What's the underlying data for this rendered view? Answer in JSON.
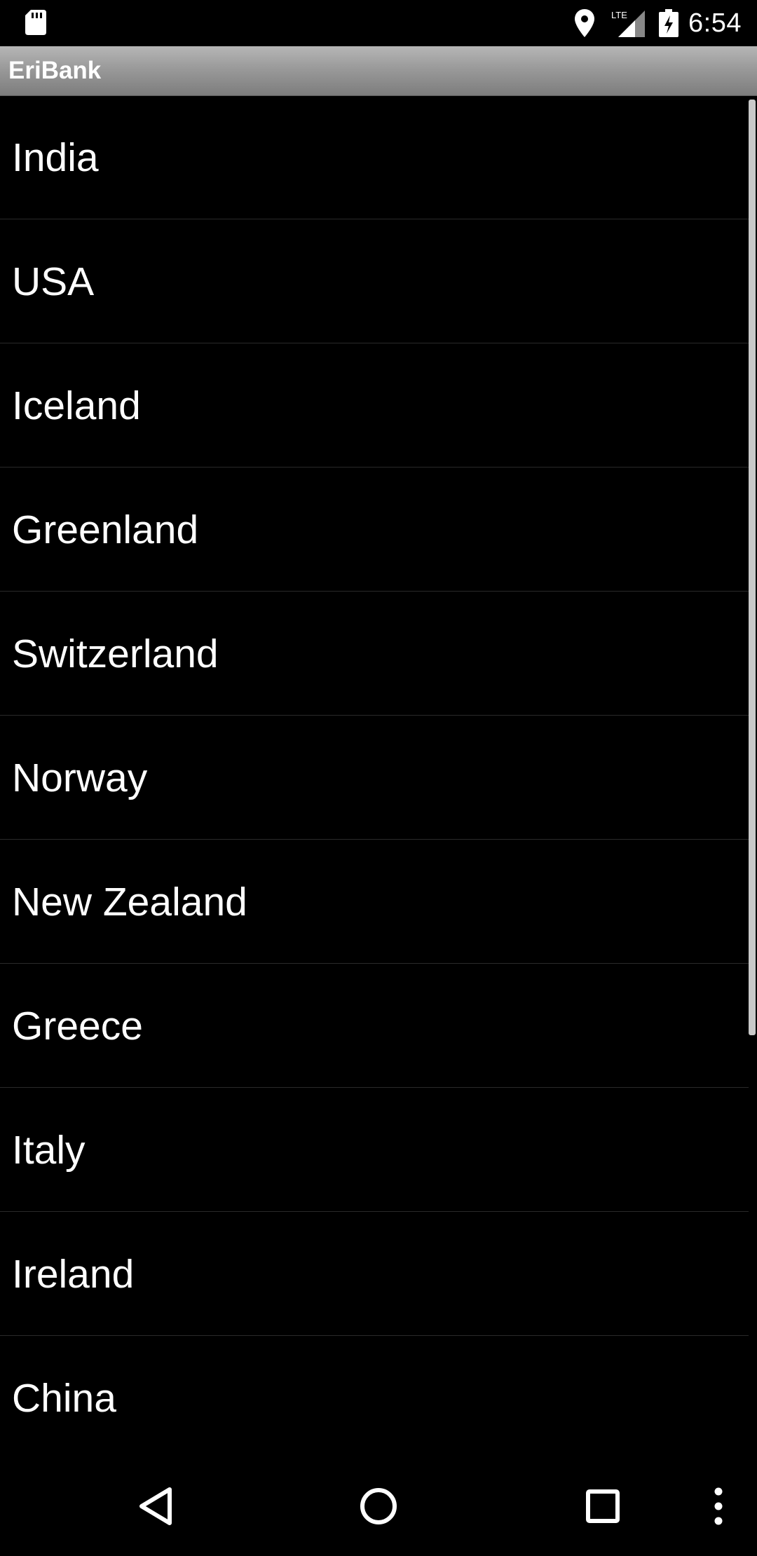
{
  "status_bar": {
    "time": "6:54",
    "network": "LTE",
    "icons": [
      "sd-card-icon",
      "location-icon",
      "lte-signal-icon",
      "battery-charging-icon"
    ]
  },
  "app": {
    "title": "EriBank"
  },
  "list": {
    "items": [
      {
        "label": "India"
      },
      {
        "label": "USA"
      },
      {
        "label": "Iceland"
      },
      {
        "label": "Greenland"
      },
      {
        "label": "Switzerland"
      },
      {
        "label": "Norway"
      },
      {
        "label": "New Zealand"
      },
      {
        "label": "Greece"
      },
      {
        "label": "Italy"
      },
      {
        "label": "Ireland"
      },
      {
        "label": "China"
      }
    ]
  },
  "nav_bar": {
    "icons": [
      "back-icon",
      "home-icon",
      "recents-icon",
      "overflow-menu-icon"
    ]
  },
  "colors": {
    "background": "#000000",
    "text": "#ffffff",
    "title_bar_top": "#b6b6b6",
    "title_bar_bottom": "#7d7d7d",
    "divider": "#2a2a2a"
  }
}
